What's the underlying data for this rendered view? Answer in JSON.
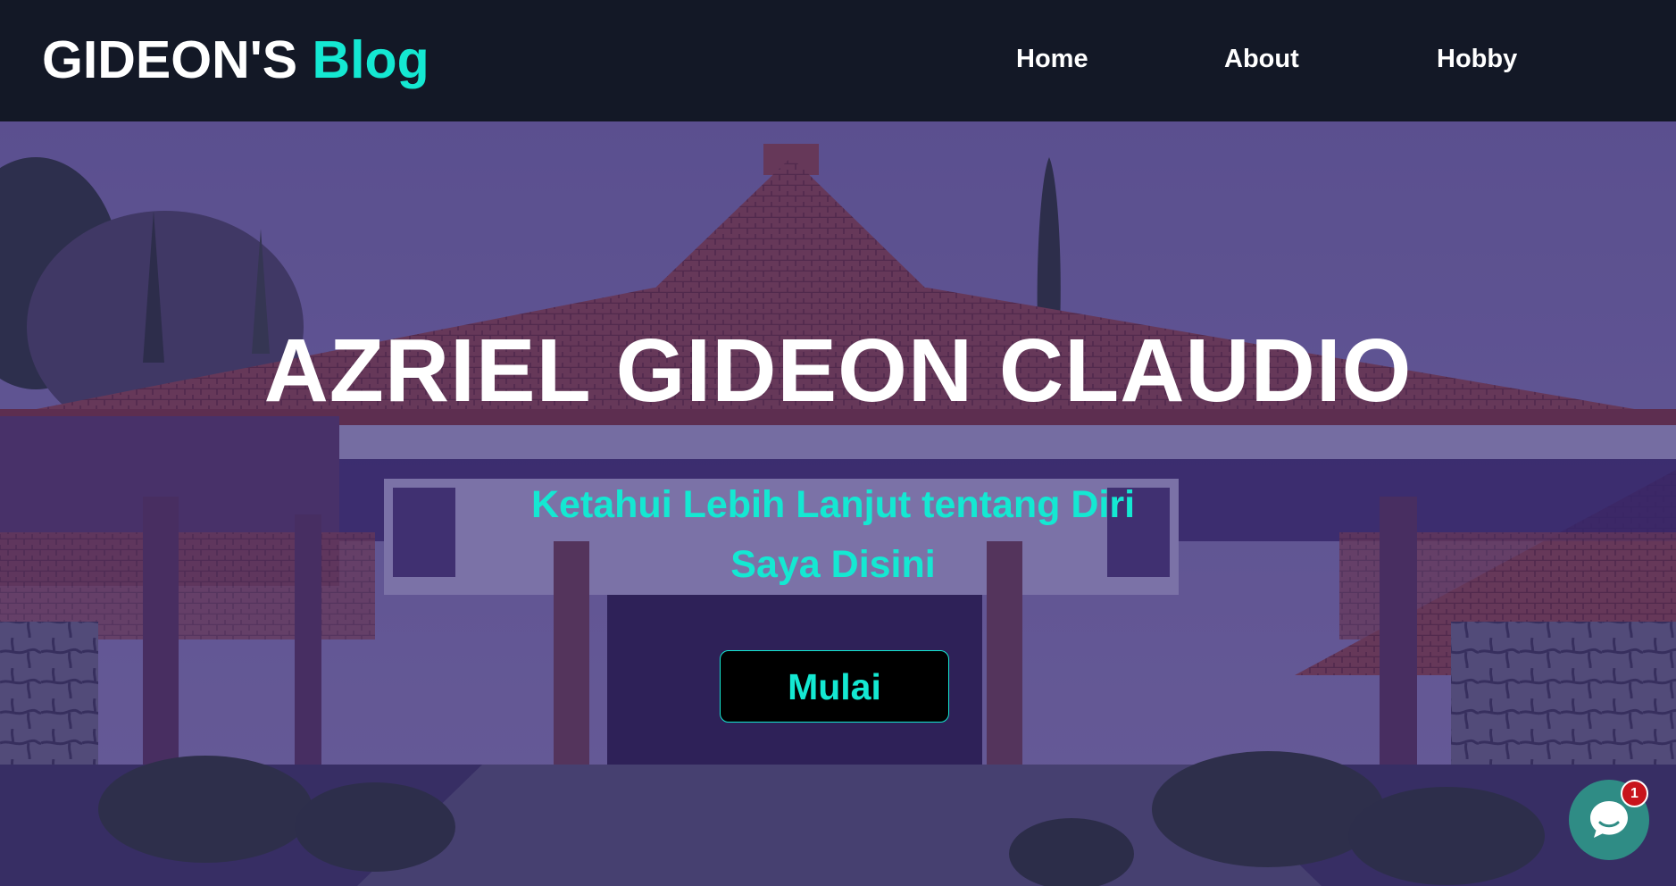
{
  "brand": {
    "primary": "GIDEON'S",
    "accent": "Blog"
  },
  "nav": {
    "home": "Home",
    "about": "About",
    "hobby": "Hobby"
  },
  "hero": {
    "title": "AZRIEL GIDEON CLAUDIO",
    "subtitle": "Ketahui Lebih Lanjut tentang Diri Saya Disini",
    "cta_label": "Mulai"
  },
  "chat": {
    "badge_count": "1",
    "icon": "chat-bubble-icon"
  },
  "colors": {
    "navbar_bg": "#131826",
    "accent": "#14e8d2",
    "overlay": "#301e6e",
    "button_bg": "#000000",
    "chat_bg": "#2f8c85",
    "badge_bg": "#c8141c"
  }
}
